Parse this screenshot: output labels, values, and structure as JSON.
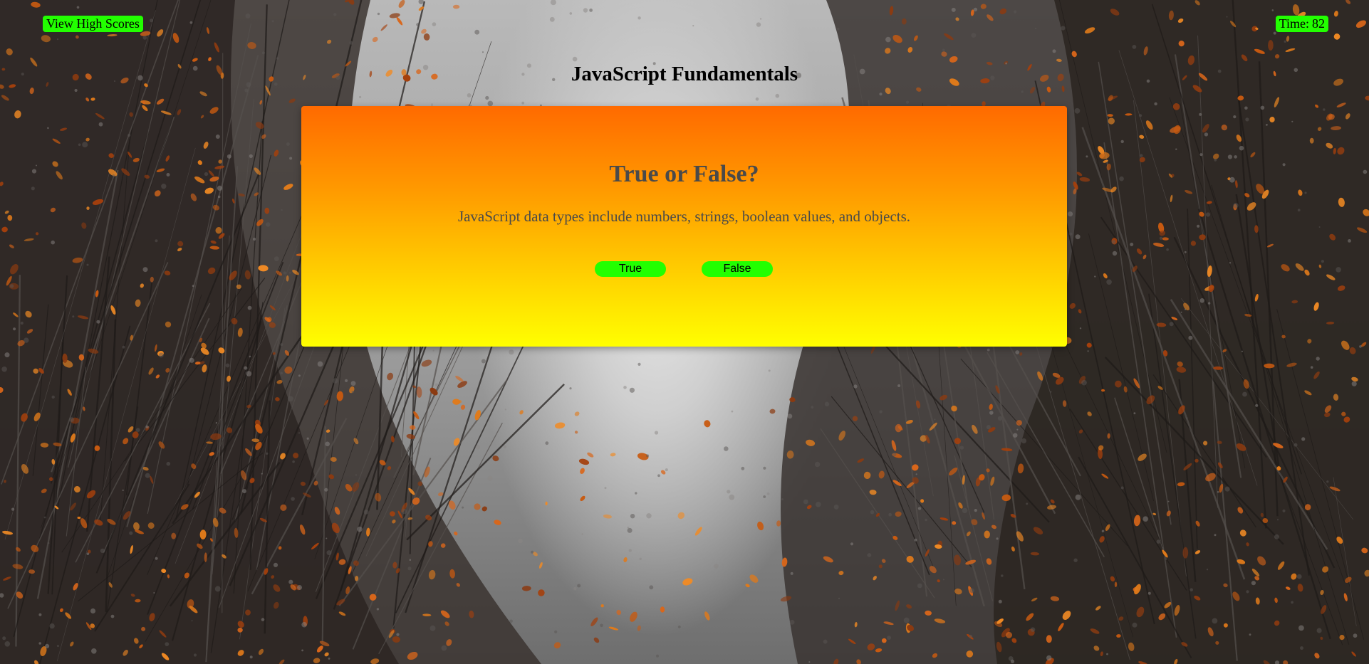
{
  "header": {
    "high_scores_label": "View High Scores",
    "timer_label": "Time:",
    "timer_value": "82"
  },
  "quiz": {
    "heading": "JavaScript Fundamentals",
    "question_title": "True or False?",
    "question_text": "JavaScript data types include numbers, strings, boolean values, and objects.",
    "answers": [
      "True",
      "False"
    ]
  },
  "colors": {
    "button_green": "#22ff00",
    "card_gradient_top": "#ff6a00",
    "card_gradient_bottom": "#ffff00",
    "text_grey": "#4a4a4a"
  },
  "background": {
    "image_subject": "autumn-forest-photo"
  }
}
